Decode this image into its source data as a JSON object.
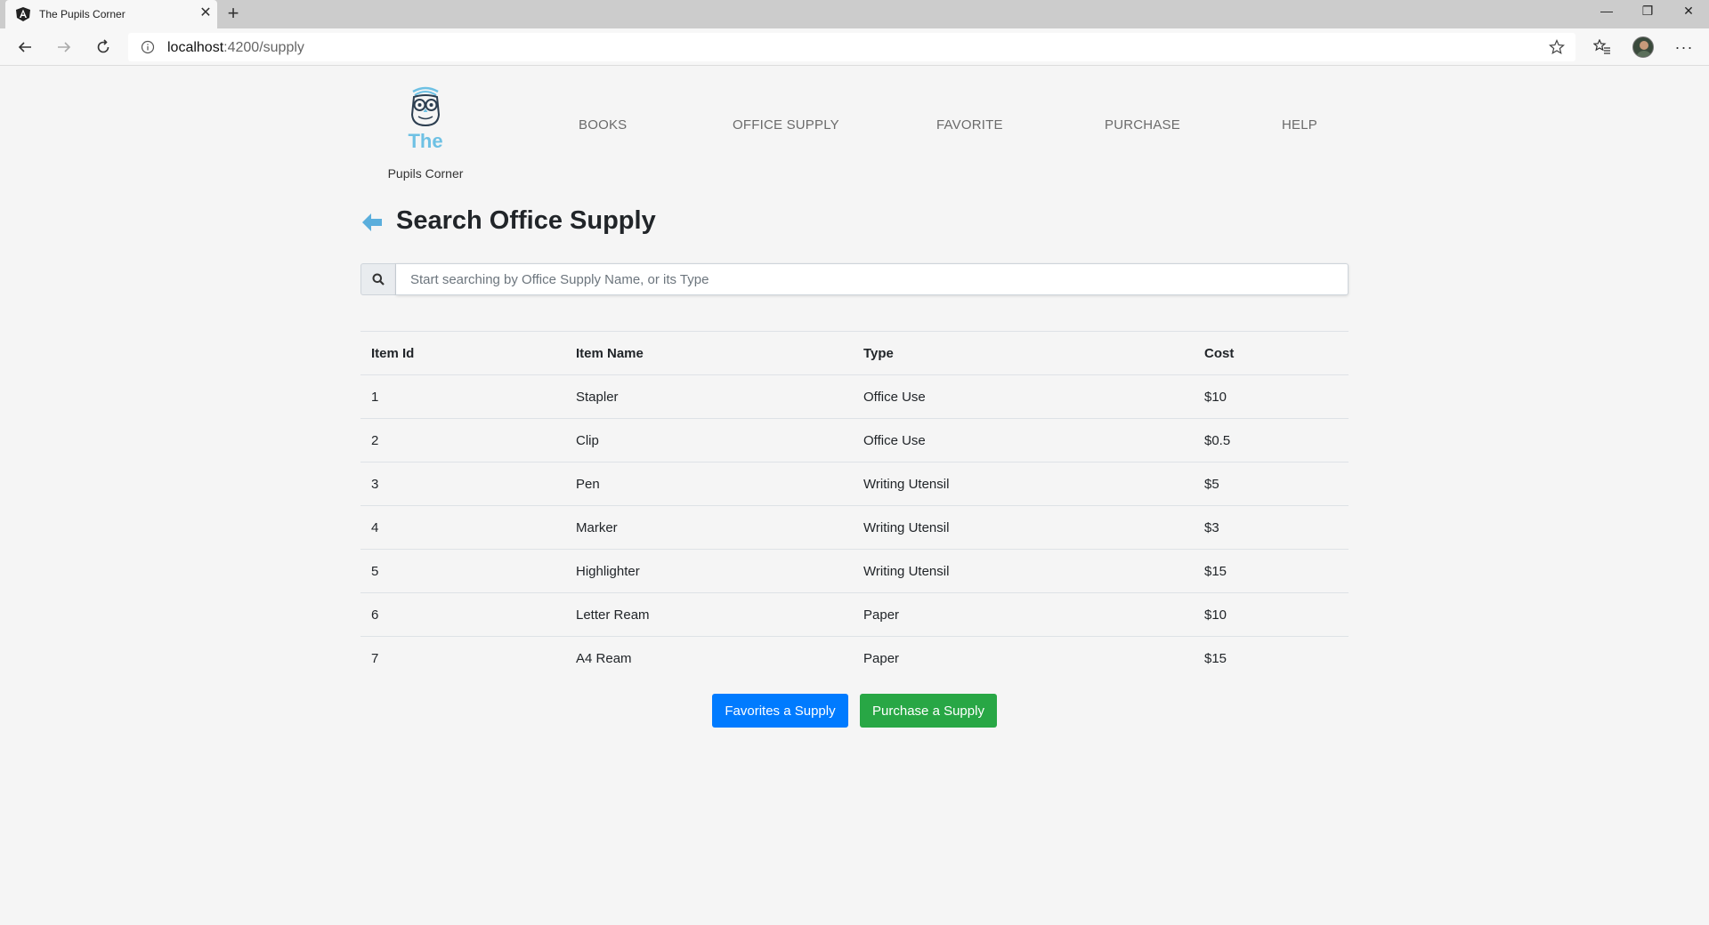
{
  "browser": {
    "tab_title": "The Pupils Corner",
    "tab_close": "✕",
    "new_tab": "+",
    "url_host": "localhost",
    "url_path": ":4200/supply",
    "more": "···",
    "window": {
      "minimize": "—",
      "maximize": "❐",
      "close": "✕"
    }
  },
  "brand": {
    "line1": "The",
    "line2": "Pupils Corner",
    "accent_color": "#6ec1e4"
  },
  "nav": {
    "books": "BOOKS",
    "office_supply": "OFFICE SUPPLY",
    "favorite": "FAVORITE",
    "purchase": "PURCHASE",
    "help": "HELP"
  },
  "page": {
    "title": "Search Office Supply"
  },
  "search": {
    "placeholder": "Start searching by Office Supply Name, or its Type",
    "value": ""
  },
  "table": {
    "headers": [
      "Item Id",
      "Item Name",
      "Type",
      "Cost"
    ],
    "rows": [
      [
        "1",
        "Stapler",
        "Office Use",
        "$10"
      ],
      [
        "2",
        "Clip",
        "Office Use",
        "$0.5"
      ],
      [
        "3",
        "Pen",
        "Writing Utensil",
        "$5"
      ],
      [
        "4",
        "Marker",
        "Writing Utensil",
        "$3"
      ],
      [
        "5",
        "Highlighter",
        "Writing Utensil",
        "$15"
      ],
      [
        "6",
        "Letter Ream",
        "Paper",
        "$10"
      ],
      [
        "7",
        "A4 Ream",
        "Paper",
        "$15"
      ]
    ]
  },
  "actions": {
    "favorite_label": "Favorites a Supply",
    "purchase_label": "Purchase a Supply",
    "favorite_color": "#007bff",
    "purchase_color": "#28a745"
  }
}
